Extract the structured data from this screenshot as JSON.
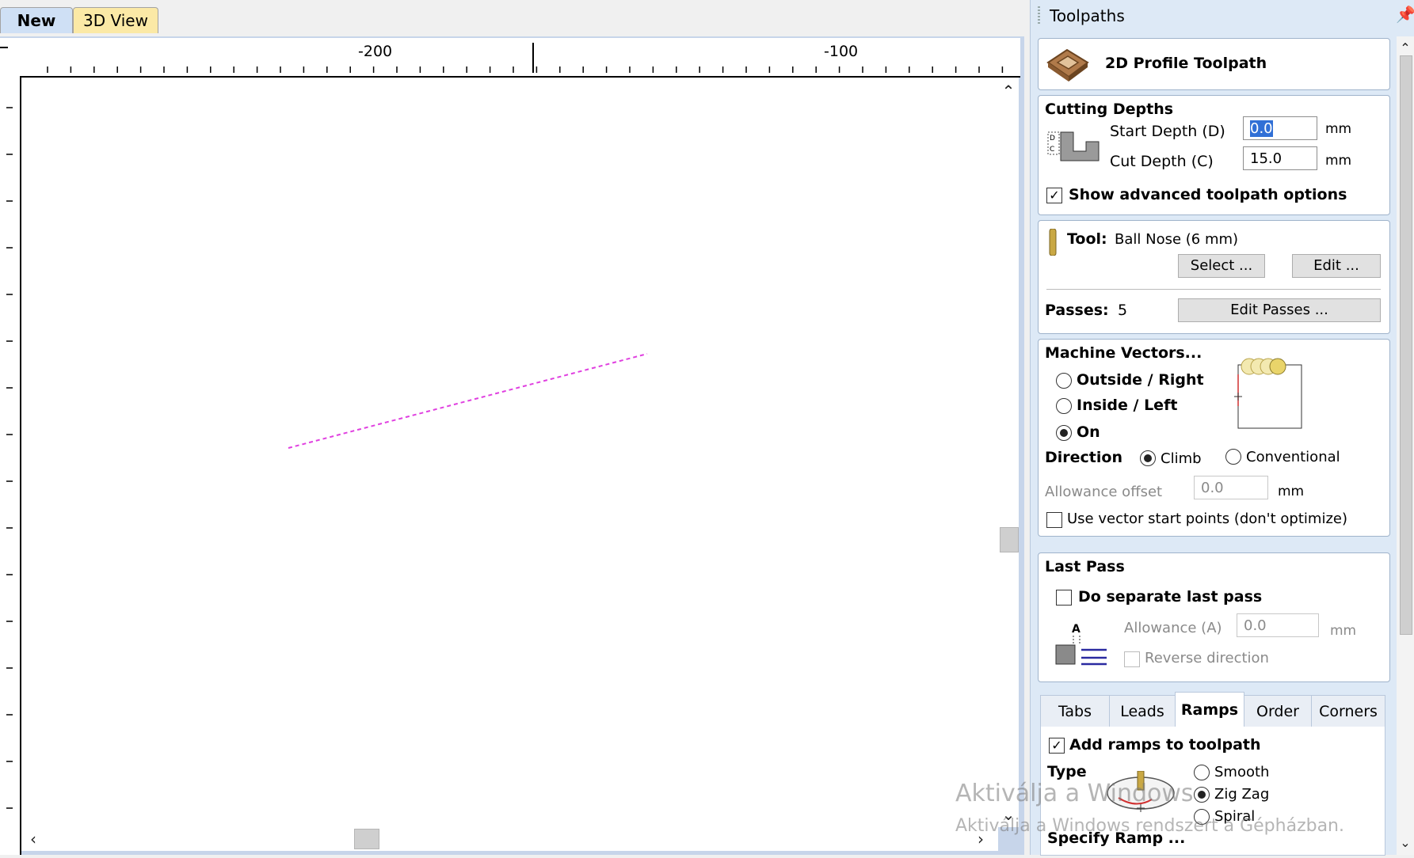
{
  "doc_tabs": [
    {
      "label": "New"
    },
    {
      "label": "3D View"
    }
  ],
  "ruler": {
    "top_labels": [
      "-200",
      "-100"
    ]
  },
  "watermark": {
    "line1": "Aktiválja a Windows",
    "line2": "Aktiválja a Windows rendszert a Gépházban."
  },
  "panel": {
    "title": "Toolpaths",
    "toolpath_name": "2D Profile Toolpath",
    "cutting_depths": {
      "title": "Cutting Depths",
      "start_label": "Start Depth (D)",
      "start_value": "0.0",
      "cut_label": "Cut Depth (C)",
      "cut_value": "15.0",
      "unit": "mm",
      "advanced_label": "Show advanced toolpath options",
      "advanced_checked": true
    },
    "tool": {
      "label": "Tool:",
      "name": "Ball Nose (6 mm)",
      "select_button": "Select ...",
      "edit_button": "Edit ...",
      "passes_label": "Passes:",
      "passes_value": "5",
      "edit_passes_button": "Edit Passes ..."
    },
    "machine_vectors": {
      "title": "Machine Vectors...",
      "options": [
        "Outside / Right",
        "Inside / Left",
        "On"
      ],
      "selected": "On",
      "direction_label": "Direction",
      "direction_options": [
        "Climb",
        "Conventional"
      ],
      "direction_selected": "Climb",
      "allowance_label": "Allowance offset",
      "allowance_value": "0.0",
      "unit": "mm",
      "start_points_label": "Use vector start points (don't optimize)"
    },
    "last_pass": {
      "title": "Last Pass",
      "separate_label": "Do separate last pass",
      "allowance_label": "Allowance (A)",
      "allowance_value": "0.0",
      "unit": "mm",
      "reverse_label": "Reverse direction",
      "icon_letter": "A"
    },
    "sub_tabs": [
      "Tabs",
      "Leads",
      "Ramps",
      "Order",
      "Corners"
    ],
    "active_sub_tab": "Ramps",
    "ramps": {
      "add_label": "Add ramps to toolpath",
      "type_label": "Type",
      "types": [
        "Smooth",
        "Zig Zag",
        "Spiral"
      ],
      "selected_type": "Zig Zag",
      "specify_label": "Specify Ramp ..."
    }
  },
  "colors": {
    "vector_line": "#e040e0",
    "accent_tab": "#cfe0f5",
    "panel_bg": "#dde9f6"
  }
}
